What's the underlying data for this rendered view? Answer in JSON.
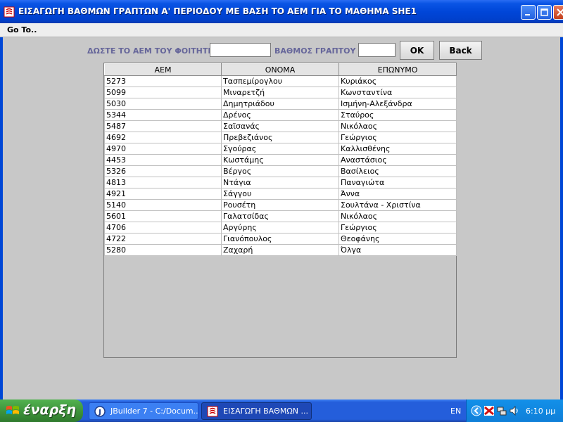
{
  "window": {
    "title": "ΕΙΣΑΓΩΓΗ ΒΑΘΜΩΝ ΓΡΑΠΤΩΝ Α' ΠΕΡΙΟΔΟΥ ΜΕ ΒΑΣΗ ΤΟ ΑΕΜ ΓΙΑ ΤΟ ΜΑΘΗΜΑ SHE1"
  },
  "menu": {
    "goto_label": "Go To.."
  },
  "form": {
    "aem_label": "ΔΩΣΤΕ ΤΟ ΑΕΜ ΤΟΥ ΦΟΙΤΗΤΗ",
    "aem_value": "",
    "grade_label": "ΒΑΘΜΟΣ ΓΡΑΠΤΟΥ",
    "grade_value": "",
    "ok_label": "OK",
    "back_label": "Back"
  },
  "table": {
    "headers": [
      "ΑΕΜ",
      "ΟΝΟΜΑ",
      "ΕΠΩΝΥΜΟ"
    ],
    "rows": [
      [
        "5273",
        "Τασπεμίρογλου",
        "Κυριάκος"
      ],
      [
        "5099",
        "Μιναρετζή",
        "Κωνσταντίνα"
      ],
      [
        "5030",
        "Δημητριάδου",
        "Ισμήνη-Αλεξάνδρα"
      ],
      [
        "5344",
        "Δρένος",
        "Σταύρος"
      ],
      [
        "5487",
        "Σαϊσανάς",
        "Νικόλαος"
      ],
      [
        "4692",
        "Πρεβεζιάνος",
        "Γεώργιος"
      ],
      [
        "4970",
        "Σγούρας",
        "Καλλισθένης"
      ],
      [
        "4453",
        "Κωστάμης",
        "Αναστάσιος"
      ],
      [
        "5326",
        "Βέργος",
        "Βασίλειος"
      ],
      [
        "4813",
        "Ντάγια",
        "Παναγιώτα"
      ],
      [
        "4921",
        "Σάγγου",
        "Άννα"
      ],
      [
        "5140",
        "Ρουσέτη",
        "Σουλτάνα - Χριστίνα"
      ],
      [
        "5601",
        "Γαλατσίδας",
        "Νικόλαος"
      ],
      [
        "4706",
        "Αργύρης",
        "Γεώργιος"
      ],
      [
        "4722",
        "Γιανόπουλος",
        "Θεοφάνης"
      ],
      [
        "5280",
        "Ζαχαρή",
        "Όλγα"
      ]
    ]
  },
  "taskbar": {
    "start_label": "έναρξη",
    "tasks": [
      {
        "label": "JBuilder 7 - C:/Docum..."
      },
      {
        "label": "ΕΙΣΑΓΩΓΗ ΒΑΘΜΩΝ ..."
      }
    ],
    "language": "EN",
    "clock": "6:10 μμ"
  },
  "colors": {
    "label_accent": "#66669a",
    "titlebar": "#0046d8",
    "start_button": "#3b8f39"
  }
}
